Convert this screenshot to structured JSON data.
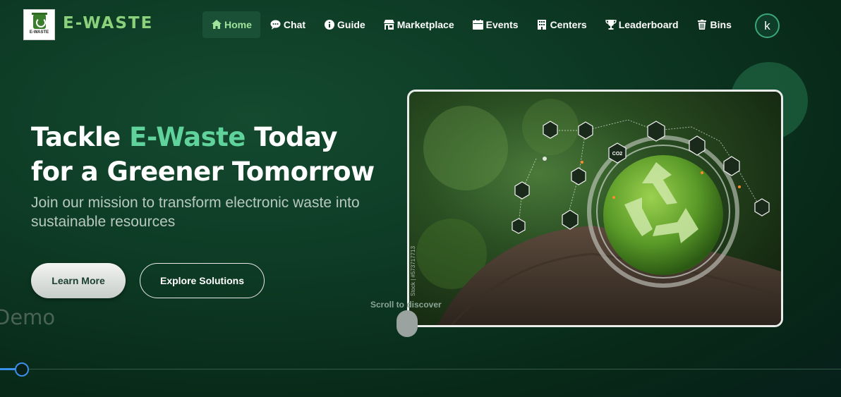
{
  "brand": {
    "name": "E-WASTE",
    "logo_text": "E-WASTE"
  },
  "nav": {
    "items": [
      {
        "label": "Home",
        "icon": "home-icon",
        "active": true
      },
      {
        "label": "Chat",
        "icon": "chat-icon",
        "active": false
      },
      {
        "label": "Guide",
        "icon": "info-icon",
        "active": false
      },
      {
        "label": "Marketplace",
        "icon": "store-icon",
        "active": false
      },
      {
        "label": "Events",
        "icon": "calendar-icon",
        "active": false
      },
      {
        "label": "Centers",
        "icon": "building-icon",
        "active": false
      },
      {
        "label": "Leaderboard",
        "icon": "trophy-icon",
        "active": false
      },
      {
        "label": "Bins",
        "icon": "trash-icon",
        "active": false
      }
    ],
    "avatar_initial": "k"
  },
  "hero": {
    "title_part1": "Tackle ",
    "title_accent": "E-Waste",
    "title_part2": " Today",
    "title_line2": "for a Greener Tomorrow",
    "subtitle": "Join our mission to transform electronic waste into sustainable resources",
    "learn_more": "Learn More",
    "explore": "Explore Solutions"
  },
  "overlay": {
    "demo": "Demo",
    "scroll_hint": "Scroll to discover"
  },
  "image": {
    "co2_label": "CO2",
    "side_text": "Stock | #573717713"
  },
  "colors": {
    "accent": "#5fd39b",
    "brand": "#8bd07b",
    "background": "#0d3a24",
    "timeline": "#3a8fe8"
  }
}
